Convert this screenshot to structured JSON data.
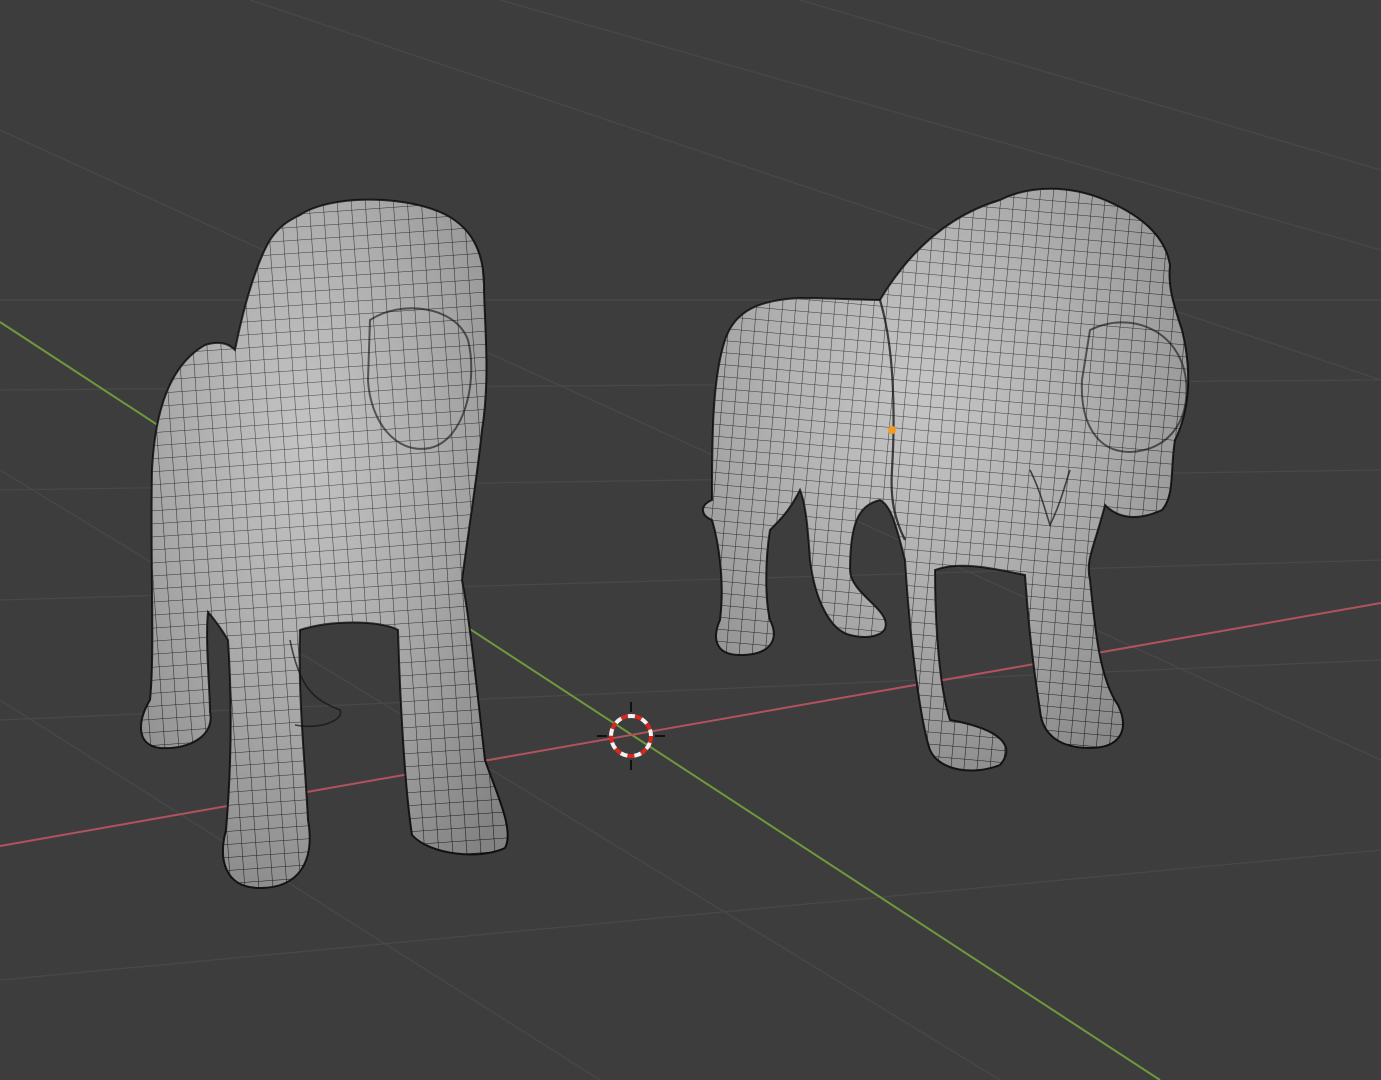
{
  "viewport": {
    "background": "#3d3d3d",
    "grid_color": "#484848",
    "x_axis_color": "#b2525d",
    "y_axis_color": "#6e9a3c",
    "mesh_fill": "#b4b4b4",
    "mesh_wire": "#1a1a1a",
    "cursor_colors": [
      "#d8281e",
      "#f2f2f2"
    ],
    "origin_color": "#f29d1f"
  },
  "objects": [
    {
      "name": "lion-low-mane",
      "label": ""
    },
    {
      "name": "lion-full-mane",
      "label": ""
    }
  ],
  "cursor": {
    "name": "3d-cursor"
  },
  "origin": {
    "name": "object-origin"
  }
}
